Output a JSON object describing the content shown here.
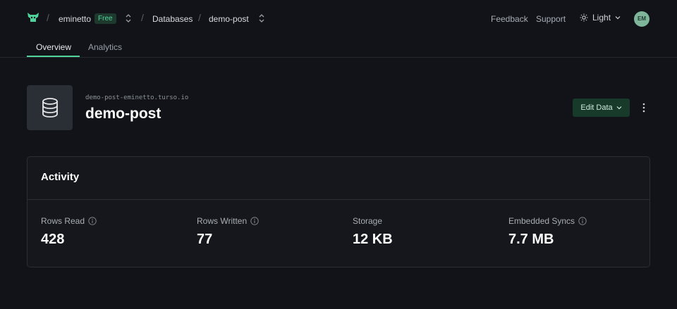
{
  "header": {
    "org": "eminetto",
    "plan_badge": "Free",
    "section": "Databases",
    "database": "demo-post",
    "feedback": "Feedback",
    "support": "Support",
    "theme": "Light",
    "avatar_initials": "EM"
  },
  "tabs": [
    {
      "label": "Overview",
      "active": true
    },
    {
      "label": "Analytics",
      "active": false
    }
  ],
  "database": {
    "url": "demo-post-eminetto.turso.io",
    "name": "demo-post",
    "edit_button": "Edit Data"
  },
  "activity": {
    "title": "Activity",
    "metrics": [
      {
        "label": "Rows Read",
        "value": "428",
        "has_info": true
      },
      {
        "label": "Rows Written",
        "value": "77",
        "has_info": true
      },
      {
        "label": "Storage",
        "value": "12 KB",
        "has_info": false
      },
      {
        "label": "Embedded Syncs",
        "value": "7.7 MB",
        "has_info": true
      }
    ]
  },
  "colors": {
    "background": "#111318",
    "accent": "#4fd39a",
    "card": "#15171c"
  }
}
